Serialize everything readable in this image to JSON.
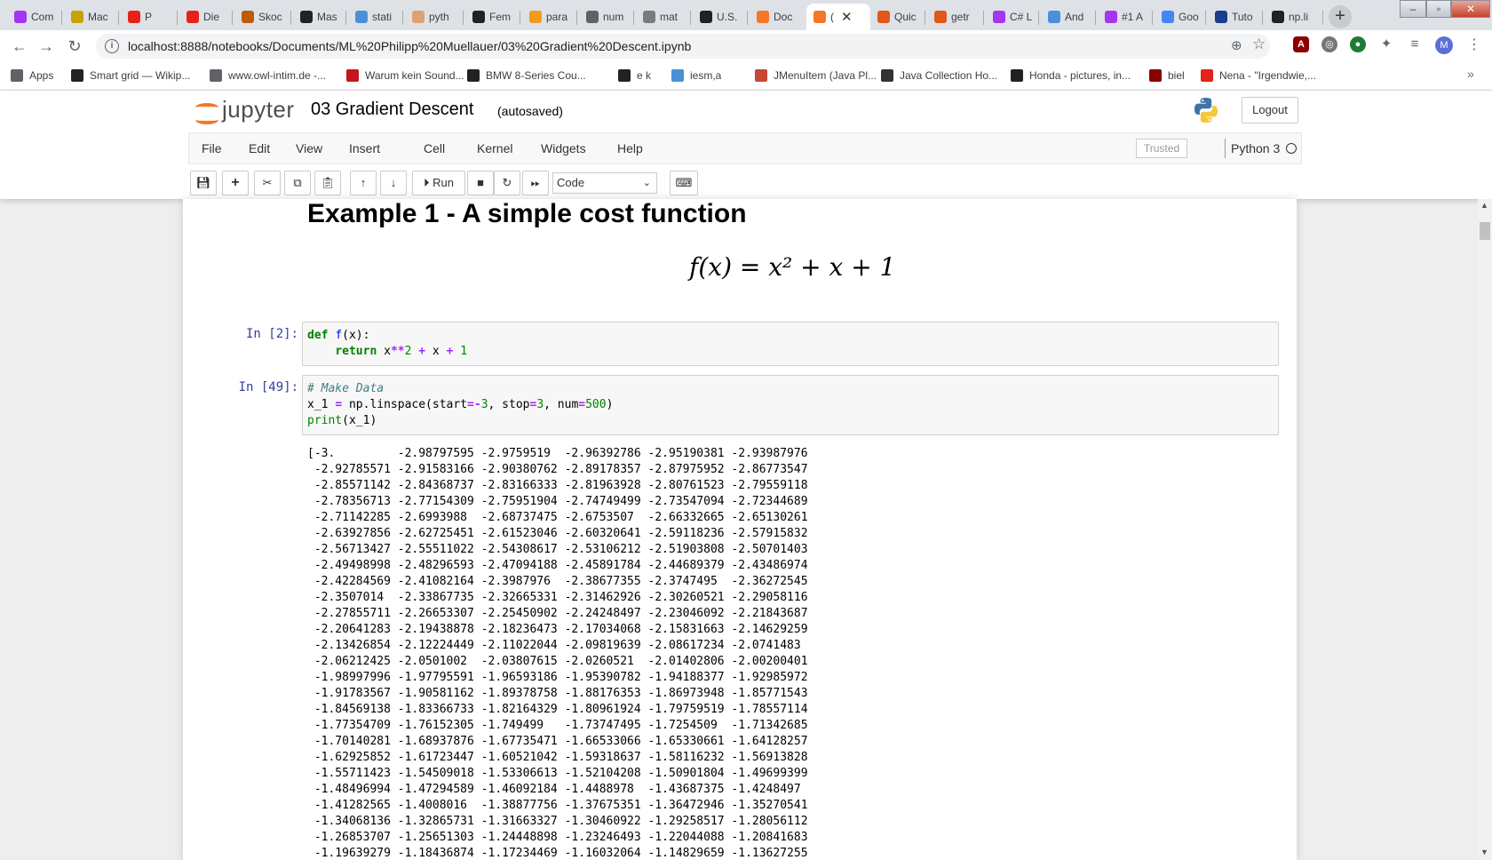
{
  "browser": {
    "tabs": [
      {
        "label": "Com",
        "icon": "udemy-icon",
        "color": "#a435f0"
      },
      {
        "label": "Mac",
        "icon": "tab-site-icon",
        "color": "#c8a200"
      },
      {
        "label": "P",
        "icon": "youtube-icon",
        "color": "#e62117"
      },
      {
        "label": "Die",
        "icon": "youtube-icon",
        "color": "#e62117"
      },
      {
        "label": "Skoc",
        "icon": "m-site-icon",
        "color": "#c05a00"
      },
      {
        "label": "Mas",
        "icon": "amazon-icon",
        "color": "#222222"
      },
      {
        "label": "stati",
        "icon": "tab-site-icon",
        "color": "#4a90d9"
      },
      {
        "label": "pyth",
        "icon": "tab-site-icon",
        "color": "#e0a070"
      },
      {
        "label": "Fem",
        "icon": "ycombinator-icon",
        "color": "#222222"
      },
      {
        "label": "para",
        "icon": "tab-site-icon",
        "color": "#f29b1d"
      },
      {
        "label": "num",
        "icon": "globe-icon",
        "color": "#5f6368"
      },
      {
        "label": "mat",
        "icon": "tab-site-icon",
        "color": "#7a7a7a"
      },
      {
        "label": "U.S.",
        "icon": "tab-site-icon",
        "color": "#222222"
      },
      {
        "label": "Doc",
        "icon": "tab-site-icon",
        "color": "#f37726"
      },
      {
        "label": "(",
        "icon": "jupyter-icon",
        "color": "#f37726"
      },
      {
        "label": "Quic",
        "icon": "tab-site-icon",
        "color": "#e0581a"
      },
      {
        "label": "getr",
        "icon": "tab-site-icon",
        "color": "#e0581a"
      },
      {
        "label": "C# L",
        "icon": "udemy-icon",
        "color": "#a435f0"
      },
      {
        "label": "And",
        "icon": "tab-site-icon",
        "color": "#4a90d9"
      },
      {
        "label": "#1 A",
        "icon": "udemy-icon",
        "color": "#a435f0"
      },
      {
        "label": "Goo",
        "icon": "translate-icon",
        "color": "#4285f4"
      },
      {
        "label": "Tuto",
        "icon": "tab-site-icon",
        "color": "#1a3e8c"
      },
      {
        "label": "np.li",
        "icon": "github-icon",
        "color": "#222222"
      }
    ],
    "url": "localhost:8888/notebooks/Documents/ML%20Philipp%20Muellauer/03%20Gradient%20Descent.ipynb",
    "bookmarks": [
      {
        "label": "Apps",
        "icon": "apps-grid-icon",
        "color": "#5f6368"
      },
      {
        "label": "Smart grid — Wikip...",
        "icon": "wikipedia-icon",
        "color": "#222222"
      },
      {
        "label": "www.owl-intim.de -...",
        "icon": "globe-icon",
        "color": "#5f6368"
      },
      {
        "label": "Warum kein Sound...",
        "icon": "b-site-icon",
        "color": "#c4161c"
      },
      {
        "label": "BMW 8-Series Cou...",
        "icon": "checkered-icon",
        "color": "#222222"
      },
      {
        "label": "e k",
        "icon": "checkered-icon",
        "color": "#222222"
      },
      {
        "label": "iesm,a",
        "icon": "tab-site-icon",
        "color": "#4a90d9"
      },
      {
        "label": "JMenuItem (Java Pl...",
        "icon": "oracle-icon",
        "color": "#c74634"
      },
      {
        "label": "Java Collection Ho...",
        "icon": "document-icon",
        "color": "#333333"
      },
      {
        "label": "Honda - pictures, in...",
        "icon": "checkered-icon",
        "color": "#222222"
      },
      {
        "label": "biel",
        "icon": "w-site-icon",
        "color": "#8b0000"
      },
      {
        "label": "Nena - \"Irgendwie,...",
        "icon": "youtube-icon",
        "color": "#e62117"
      }
    ]
  },
  "jupyter": {
    "logo_text": "jupyter",
    "notebook_title": "03 Gradient Descent",
    "autosave": "(autosaved)",
    "logout": "Logout",
    "menus": [
      "File",
      "Edit",
      "View",
      "Insert",
      "Cell",
      "Kernel",
      "Widgets",
      "Help"
    ],
    "trusted": "Trusted",
    "kernel": "Python 3",
    "run_label": "Run",
    "cell_type": "Code"
  },
  "notebook": {
    "heading": "Example 1 - A simple cost function",
    "formula": "f(x) = x² + x + 1",
    "cells": [
      {
        "prompt": "In [2]:",
        "lines": [
          "def f(x):",
          "    return x**2 + x + 1"
        ]
      },
      {
        "prompt": "In [49]:",
        "lines": [
          "# Make Data",
          "x_1 = np.linspace(start=-3, stop=3, num=500)",
          "print(x_1)"
        ]
      }
    ],
    "output": [
      "[-3.         -2.98797595 -2.9759519  -2.96392786 -2.95190381 -2.93987976",
      " -2.92785571 -2.91583166 -2.90380762 -2.89178357 -2.87975952 -2.86773547",
      " -2.85571142 -2.84368737 -2.83166333 -2.81963928 -2.80761523 -2.79559118",
      " -2.78356713 -2.77154309 -2.75951904 -2.74749499 -2.73547094 -2.72344689",
      " -2.71142285 -2.6993988  -2.68737475 -2.6753507  -2.66332665 -2.65130261",
      " -2.63927856 -2.62725451 -2.61523046 -2.60320641 -2.59118236 -2.57915832",
      " -2.56713427 -2.55511022 -2.54308617 -2.53106212 -2.51903808 -2.50701403",
      " -2.49498998 -2.48296593 -2.47094188 -2.45891784 -2.44689379 -2.43486974",
      " -2.42284569 -2.41082164 -2.3987976  -2.38677355 -2.3747495  -2.36272545",
      " -2.3507014  -2.33867735 -2.32665331 -2.31462926 -2.30260521 -2.29058116",
      " -2.27855711 -2.26653307 -2.25450902 -2.24248497 -2.23046092 -2.21843687",
      " -2.20641283 -2.19438878 -2.18236473 -2.17034068 -2.15831663 -2.14629259",
      " -2.13426854 -2.12224449 -2.11022044 -2.09819639 -2.08617234 -2.0741483",
      " -2.06212425 -2.0501002  -2.03807615 -2.0260521  -2.01402806 -2.00200401",
      " -1.98997996 -1.97795591 -1.96593186 -1.95390782 -1.94188377 -1.92985972",
      " -1.91783567 -1.90581162 -1.89378758 -1.88176353 -1.86973948 -1.85771543",
      " -1.84569138 -1.83366733 -1.82164329 -1.80961924 -1.79759519 -1.78557114",
      " -1.77354709 -1.76152305 -1.749499   -1.73747495 -1.7254509  -1.71342685",
      " -1.70140281 -1.68937876 -1.67735471 -1.66533066 -1.65330661 -1.64128257",
      " -1.62925852 -1.61723447 -1.60521042 -1.59318637 -1.58116232 -1.56913828",
      " -1.55711423 -1.54509018 -1.53306613 -1.52104208 -1.50901804 -1.49699399",
      " -1.48496994 -1.47294589 -1.46092184 -1.4488978  -1.43687375 -1.4248497",
      " -1.41282565 -1.4008016  -1.38877756 -1.37675351 -1.36472946 -1.35270541",
      " -1.34068136 -1.32865731 -1.31663327 -1.30460922 -1.29258517 -1.28056112",
      " -1.26853707 -1.25651303 -1.24448898 -1.23246493 -1.22044088 -1.20841683",
      " -1.19639279 -1.18436874 -1.17234469 -1.16032064 -1.14829659 -1.13627255"
    ]
  }
}
